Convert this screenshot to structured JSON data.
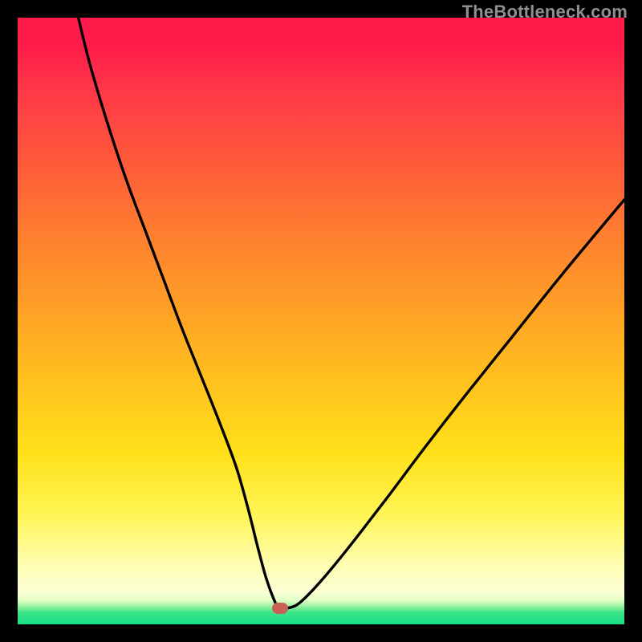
{
  "watermark": "TheBottleneck.com",
  "chart_data": {
    "type": "line",
    "title": "",
    "xlabel": "",
    "ylabel": "",
    "x_range": [
      0,
      100
    ],
    "y_range": [
      0,
      100
    ],
    "series": [
      {
        "name": "curve",
        "x": [
          10,
          12,
          15,
          18,
          21,
          24,
          27,
          30,
          33,
          36,
          38,
          39.5,
          41,
          42.5,
          43.2,
          44,
          46,
          48.5,
          52,
          56,
          61,
          67,
          74,
          82,
          90,
          100
        ],
        "y": [
          100,
          92,
          82,
          73,
          65,
          57,
          49,
          41.5,
          34,
          26,
          19,
          13,
          7.5,
          3.5,
          2.6,
          2.6,
          3.2,
          5.5,
          9.5,
          14.5,
          21,
          29,
          38,
          48,
          58,
          70
        ]
      }
    ],
    "marker": {
      "x": 43.2,
      "y": 2.6,
      "color": "#c96057"
    },
    "gradient_stops": [
      {
        "pos": 0.0,
        "color": "#ff1a4a"
      },
      {
        "pos": 0.6,
        "color": "#ffc11e"
      },
      {
        "pos": 0.9,
        "color": "#fffdb0"
      },
      {
        "pos": 1.0,
        "color": "#17dd82"
      }
    ]
  }
}
